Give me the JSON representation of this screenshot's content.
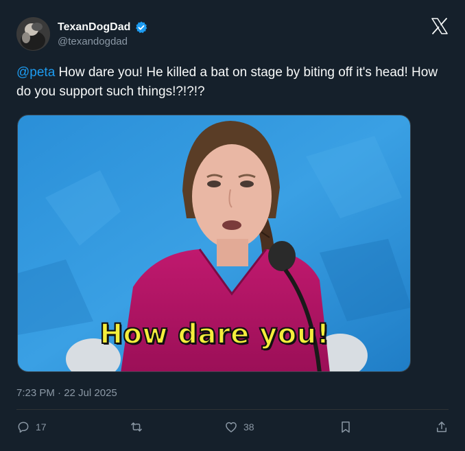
{
  "author": {
    "display_name": "TexanDogDad",
    "handle": "@texandogdad",
    "verified_icon": "verified-badge-icon",
    "verified_color": "#1d9bf0"
  },
  "tweet": {
    "mention": "@peta",
    "text": " How dare you! He killed a bat on stage by biting off it's head! How do you support such things!?!?!?",
    "timestamp": "7:23 PM · 22 Jul 2025"
  },
  "media": {
    "caption": "How dare you!"
  },
  "actions": {
    "reply_count": "17",
    "retweet_count": "",
    "like_count": "38"
  },
  "colors": {
    "background": "#15202b",
    "text": "#f7f9f9",
    "secondary_text": "#8b98a5",
    "accent": "#1d9bf0",
    "caption_yellow": "#f4ee3c"
  }
}
